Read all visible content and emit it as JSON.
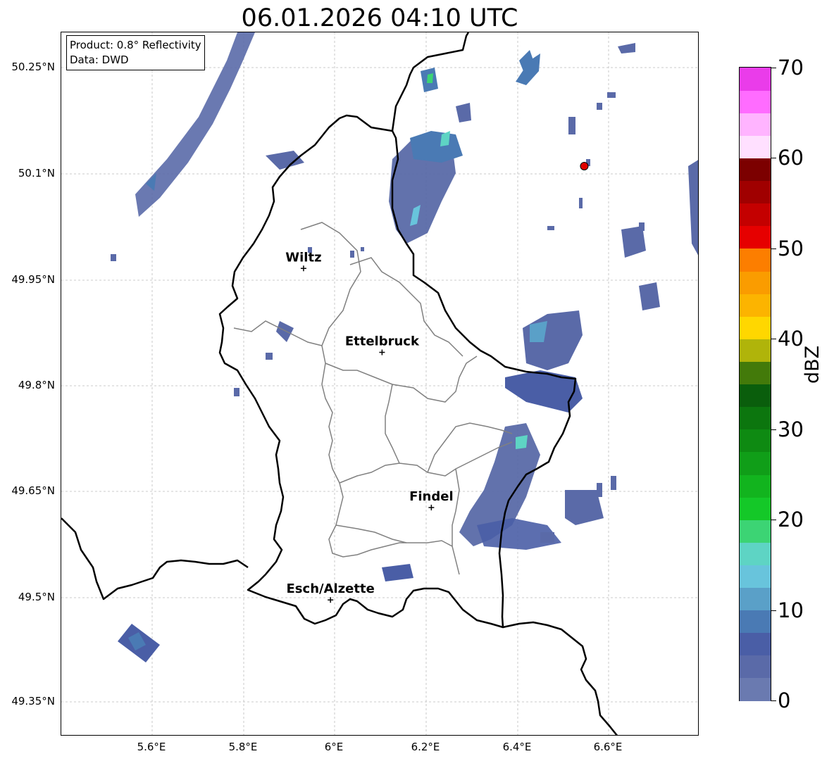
{
  "title": "06.01.2026 04:10 UTC",
  "info": {
    "product": "Product: 0.8° Reflectivity",
    "data": "Data: DWD"
  },
  "map": {
    "lat_labels": [
      "50.25°N",
      "50.1°N",
      "49.95°N",
      "49.8°N",
      "49.65°N",
      "49.5°N",
      "49.35°N"
    ],
    "lon_labels": [
      "5.6°E",
      "5.8°E",
      "6°E",
      "6.2°E",
      "6.4°E",
      "6.6°E"
    ],
    "towns": [
      {
        "name": "Wiltz",
        "lat": 49.966,
        "lon": 5.932
      },
      {
        "name": "Ettelbruck",
        "lat": 49.847,
        "lon": 6.104
      },
      {
        "name": "Findel",
        "lat": 49.627,
        "lon": 6.212
      },
      {
        "name": "Esch/Alzette",
        "lat": 49.496,
        "lon": 5.991
      }
    ],
    "marker": {
      "lat": 50.111,
      "lon": 6.547,
      "color": "#e00000"
    }
  },
  "colorbar": {
    "label": "dBZ",
    "ticks": [
      "0",
      "10",
      "20",
      "30",
      "40",
      "50",
      "60",
      "70"
    ],
    "colors": [
      "#6a7ab0",
      "#5a6aa8",
      "#4a5ea6",
      "#4a7ab4",
      "#5aa0c8",
      "#68c4dc",
      "#5ed4c4",
      "#3cd474",
      "#14c828",
      "#12b41e",
      "#109e18",
      "#0e8a12",
      "#0c760e",
      "#0a5e0c",
      "#437a0a",
      "#b0b40a",
      "#ffd700",
      "#fcb400",
      "#fa9c00",
      "#fc7e00",
      "#e60000",
      "#c40000",
      "#a00000",
      "#7c0000",
      "#ffe0ff",
      "#ffb4ff",
      "#ff6cff",
      "#ea3cea"
    ]
  }
}
